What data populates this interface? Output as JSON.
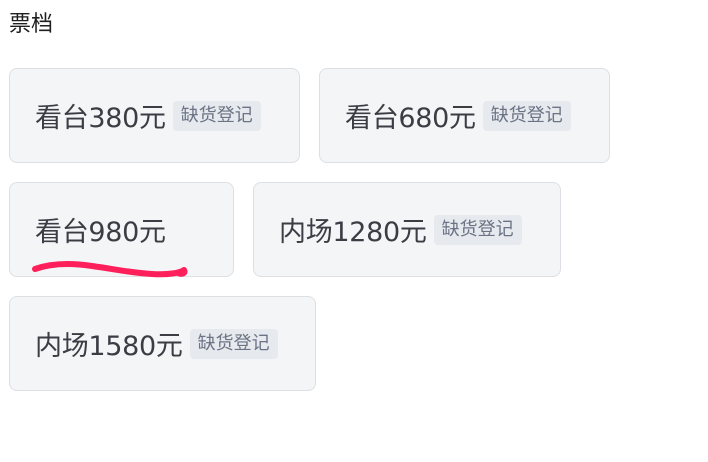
{
  "section": {
    "title": "票档"
  },
  "tickets": [
    {
      "name": "看台380元",
      "badge": "缺货登记"
    },
    {
      "name": "看台680元",
      "badge": "缺货登记"
    },
    {
      "name": "看台980元",
      "badge": ""
    },
    {
      "name": "内场1280元",
      "badge": "缺货登记"
    },
    {
      "name": "内场1580元",
      "badge": "缺货登记"
    }
  ],
  "colors": {
    "card_bg": "#f4f5f7",
    "card_border": "#dcdfe3",
    "badge_bg": "#e6e9ee",
    "badge_text": "#6b7384",
    "annotation_underline": "#ff1f5a"
  }
}
